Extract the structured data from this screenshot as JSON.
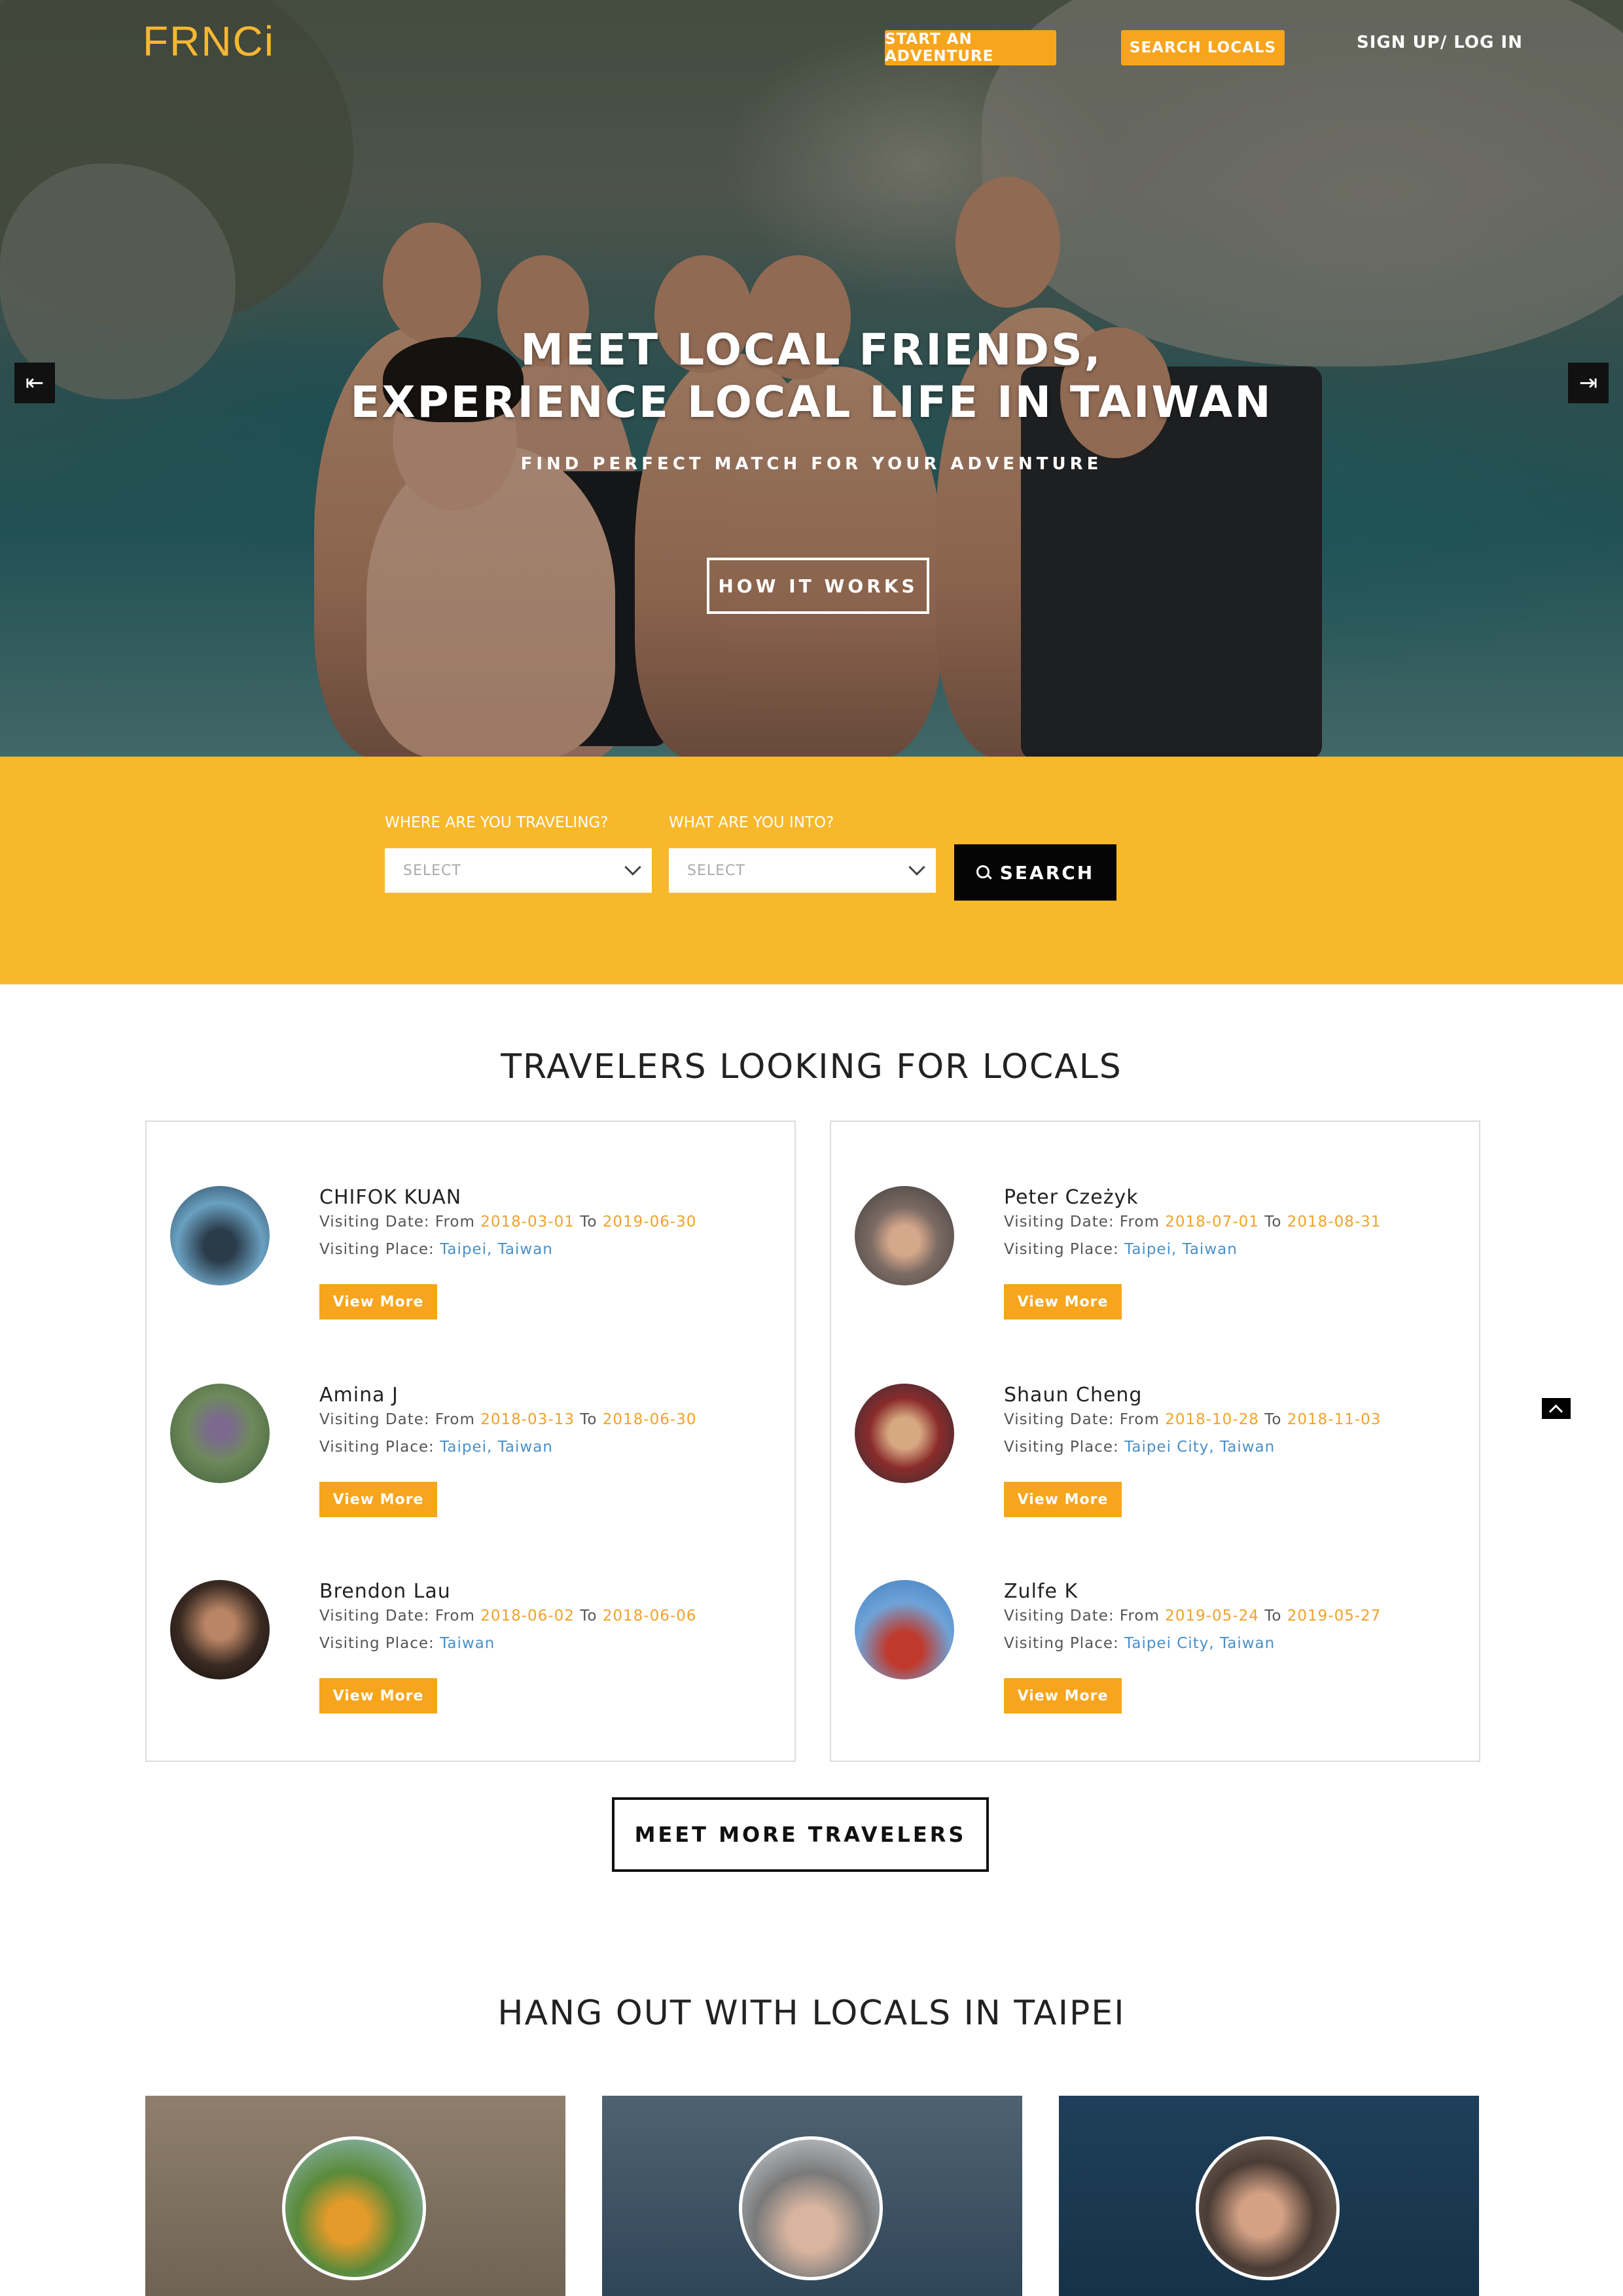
{
  "header": {
    "logo": "FRNCi",
    "start_adventure": "START AN ADVENTURE",
    "search_locals": "SEARCH LOCALS",
    "signup_login": "SIGN UP/ LOG IN"
  },
  "hero": {
    "title_line1": "MEET LOCAL FRIENDS,",
    "title_line2": "EXPERIENCE LOCAL LIFE IN TAIWAN",
    "subtitle": "FIND PERFECT MATCH FOR YOUR ADVENTURE",
    "cta": "HOW IT WORKS",
    "prev_icon": "arrow-left-icon",
    "next_icon": "arrow-right-icon"
  },
  "search": {
    "where_label": "WHERE ARE YOU TRAVELING?",
    "where_value": "SELECT",
    "into_label": "WHAT ARE YOU INTO?",
    "into_value": "SELECT",
    "button": "SEARCH"
  },
  "travelers": {
    "title": "TRAVELERS LOOKING FOR LOCALS",
    "date_prefix": "Visiting Date: From",
    "date_to": "To",
    "place_prefix": "Visiting Place:",
    "view_more": "View More",
    "left": [
      {
        "name": "CHIFOK KUAN",
        "from": "2018-03-01",
        "to": "2019-06-30",
        "place": "Taipei, Taiwan"
      },
      {
        "name": "Amina J",
        "from": "2018-03-13",
        "to": "2018-06-30",
        "place": "Taipei, Taiwan"
      },
      {
        "name": "Brendon Lau",
        "from": "2018-06-02",
        "to": "2018-06-06",
        "place": "Taiwan"
      }
    ],
    "right": [
      {
        "name": "Peter Czeżyk",
        "from": "2018-07-01",
        "to": "2018-08-31",
        "place": "Taipei, Taiwan"
      },
      {
        "name": "Shaun Cheng",
        "from": "2018-10-28",
        "to": "2018-11-03",
        "place": "Taipei City, Taiwan"
      },
      {
        "name": "Zulfe K",
        "from": "2019-05-24",
        "to": "2019-05-27",
        "place": "Taipei City, Taiwan"
      }
    ],
    "more_button": "MEET MORE TRAVELERS"
  },
  "locals": {
    "title": "HANG OUT WITH LOCALS IN TAIPEI"
  },
  "colors": {
    "brand_yellow": "#f8b82c",
    "button_orange": "#f7a51d",
    "date_orange": "#f0a22a",
    "place_blue": "#4a90c8"
  }
}
